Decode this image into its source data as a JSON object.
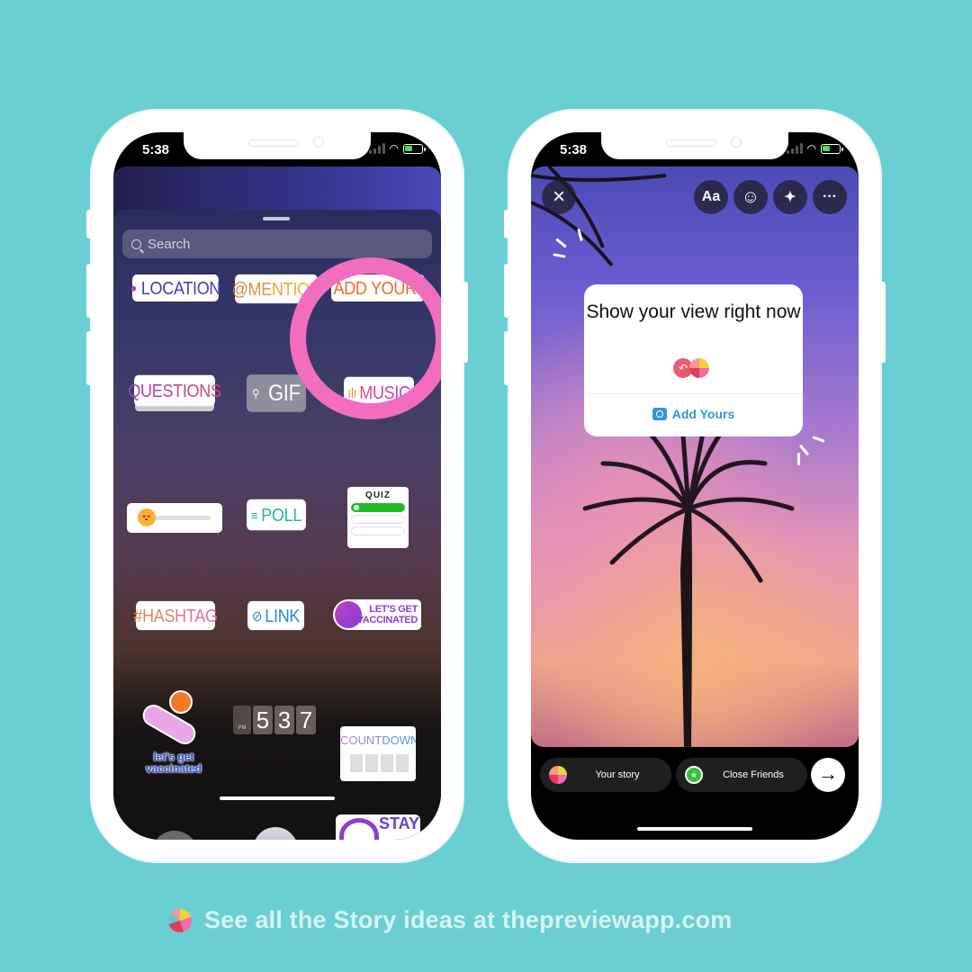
{
  "footer": {
    "logo_icon": "preview-app-logo-icon",
    "text": "See all the Story ideas at thepreviewapp.com"
  },
  "left_phone": {
    "status": {
      "time": "5:38"
    },
    "sticker_tray": {
      "search_placeholder": "Search",
      "stickers": {
        "location": "LOCATION",
        "mention": "@MENTION",
        "add_yours": "ADD YOURS",
        "questions": "QUESTIONS",
        "gif": "GIF",
        "music": "MUSIC",
        "slider_emoji": "😍",
        "poll": "POLL",
        "quiz": "QUIZ",
        "hashtag": "#HASHTAG",
        "link": "LINK",
        "vaccinated_line1": "LET'S GET",
        "vaccinated_line2": "VACCINATED",
        "vax_art_line1": "let's get",
        "vax_art_line2": "vaccinated",
        "time_pm": "PM",
        "time_digits": [
          "5",
          "3",
          "7"
        ],
        "countdown": "COUNTDOWN",
        "stay_home": "STAY"
      },
      "highlight_color": "#f36dbe"
    }
  },
  "right_phone": {
    "status": {
      "time": "5:38"
    },
    "top_controls": {
      "close_icon": "×",
      "text_label": "Aa",
      "sticker_icon": "☺",
      "effects_icon": "✦",
      "more_icon": "···"
    },
    "add_yours_card": {
      "prompt": "Show your view right now",
      "reply_icon": "↶",
      "action_label": "Add Yours",
      "accent": "#3097d9"
    },
    "share_bar": {
      "your_story": "Your story",
      "close_friends": "Close Friends",
      "next_icon": "→"
    }
  }
}
